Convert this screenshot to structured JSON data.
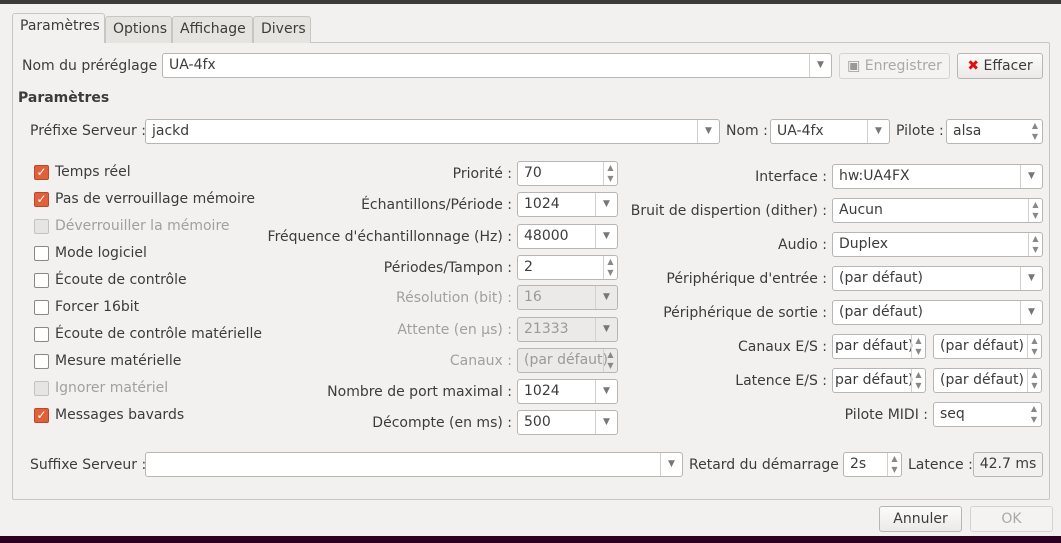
{
  "tabs": [
    {
      "label": "Paramètres",
      "active": true
    },
    {
      "label": "Options"
    },
    {
      "label": "Affichage"
    },
    {
      "label": "Divers"
    }
  ],
  "preset": {
    "label": "Nom du préréglage :",
    "value": "UA-4fx",
    "save_label": "Enregistrer",
    "clear_label": "Effacer"
  },
  "section_title": "Paramètres",
  "server": {
    "prefix_label": "Préfixe Serveur :",
    "prefix_value": "jackd",
    "name_label": "Nom :",
    "name_value": "UA-4fx",
    "driver_label": "Pilote :",
    "driver_value": "alsa"
  },
  "checkboxes": [
    {
      "label": "Temps réel",
      "checked": true
    },
    {
      "label": "Pas de verrouillage mémoire",
      "checked": true
    },
    {
      "label": "Déverrouiller la mémoire",
      "checked": false,
      "disabled": true
    },
    {
      "label": "Mode logiciel",
      "checked": false
    },
    {
      "label": "Écoute de contrôle",
      "checked": false
    },
    {
      "label": "Forcer 16bit",
      "checked": false
    },
    {
      "label": "Écoute de contrôle matérielle",
      "checked": false
    },
    {
      "label": "Mesure matérielle",
      "checked": false
    },
    {
      "label": "Ignorer matériel",
      "checked": false,
      "disabled": true
    },
    {
      "label": "Messages bavards",
      "checked": true
    }
  ],
  "middle": [
    {
      "label": "Priorité :",
      "value": "70",
      "kind": "spin"
    },
    {
      "label": "Échantillons/Période :",
      "value": "1024",
      "kind": "combo"
    },
    {
      "label": "Fréquence d'échantillonnage (Hz) :",
      "value": "48000",
      "kind": "combo"
    },
    {
      "label": "Périodes/Tampon :",
      "value": "2",
      "kind": "spin"
    },
    {
      "label": "Résolution (bit) :",
      "value": "16",
      "kind": "combo",
      "disabled": true
    },
    {
      "label": "Attente (en µs) :",
      "value": "21333",
      "kind": "combo",
      "disabled": true
    },
    {
      "label": "Canaux :",
      "value": "(par défaut)",
      "kind": "spin",
      "disabled": true
    },
    {
      "label": "Nombre de port maximal :",
      "value": "1024",
      "kind": "combo"
    },
    {
      "label": "Décompte (en ms) :",
      "value": "500",
      "kind": "combo"
    }
  ],
  "right": [
    {
      "label": "Interface :",
      "value": "hw:UA4FX",
      "kind": "combo"
    },
    {
      "label": "Bruit de dispertion (dither) :",
      "value": "Aucun",
      "kind": "spin"
    },
    {
      "label": "Audio :",
      "value": "Duplex",
      "kind": "spin"
    },
    {
      "label": "Périphérique d'entrée :",
      "value": "(par défaut)",
      "kind": "combo"
    },
    {
      "label": "Périphérique de sortie :",
      "value": "(par défaut)",
      "kind": "combo"
    }
  ],
  "io": {
    "channels_label": "Canaux E/S :",
    "channels_in": "par défaut)",
    "channels_out": "(par défaut)",
    "latency_label": "Latence E/S :",
    "latency_in": "par défaut)",
    "latency_out": "(par défaut)",
    "midi_label": "Pilote MIDI :",
    "midi_value": "seq"
  },
  "bottom": {
    "suffix_label": "Suffixe Serveur :",
    "suffix_value": "",
    "delay_label": "Retard du démarrage :",
    "delay_value": "2s",
    "latency_label": "Latence :",
    "latency_value": "42.7 ms"
  },
  "dialog": {
    "cancel_label": "Annuler",
    "ok_label": "OK"
  }
}
